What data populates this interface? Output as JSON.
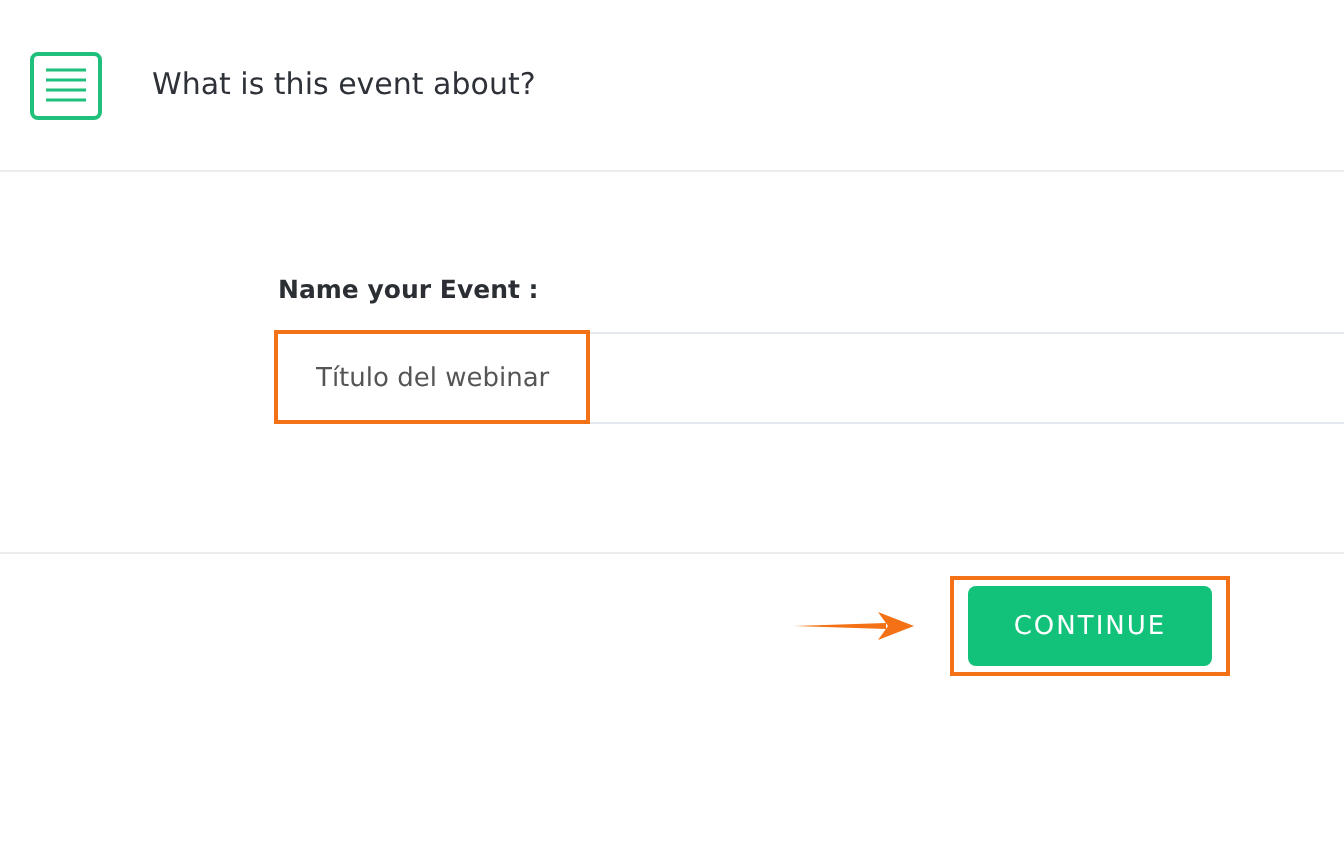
{
  "header": {
    "title": "What is this event about?"
  },
  "form": {
    "label": "Name your Event :",
    "value": "Título del webinar",
    "highlighted": true
  },
  "actions": {
    "button": "CONTINUE",
    "highlighted": true,
    "arrow": true
  }
}
